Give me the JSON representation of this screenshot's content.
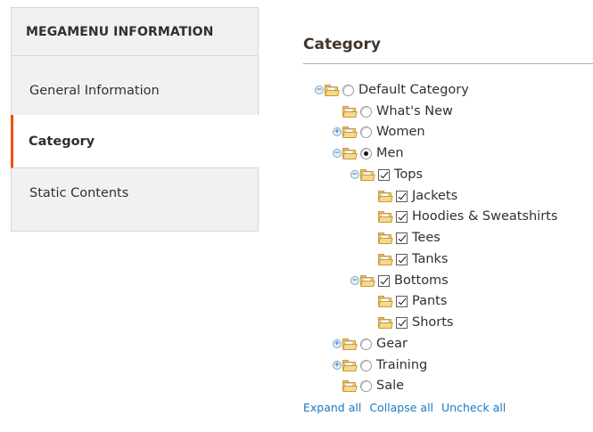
{
  "sidebar": {
    "title": "MEGAMENU INFORMATION",
    "tabs": [
      {
        "label": "General Information"
      },
      {
        "label": "Category"
      },
      {
        "label": "Static Contents"
      }
    ],
    "active_tab": "Category",
    "accent_color": "#eb5202"
  },
  "main": {
    "title": "Category",
    "tree": [
      {
        "label": "Default Category",
        "toggle": "minus",
        "control": "radio",
        "checked": false
      },
      {
        "label": "What's New",
        "toggle": "none",
        "control": "radio",
        "checked": false
      },
      {
        "label": "Women",
        "toggle": "plus",
        "control": "radio",
        "checked": false
      },
      {
        "label": "Men",
        "toggle": "minus",
        "control": "radio",
        "checked": true
      },
      {
        "label": "Tops",
        "toggle": "minus",
        "control": "checkbox",
        "checked": true
      },
      {
        "label": "Jackets",
        "toggle": "none",
        "control": "checkbox",
        "checked": true
      },
      {
        "label": "Hoodies & Sweatshirts",
        "toggle": "none",
        "control": "checkbox",
        "checked": true
      },
      {
        "label": "Tees",
        "toggle": "none",
        "control": "checkbox",
        "checked": true
      },
      {
        "label": "Tanks",
        "toggle": "none",
        "control": "checkbox",
        "checked": true
      },
      {
        "label": "Bottoms",
        "toggle": "minus",
        "control": "checkbox",
        "checked": true
      },
      {
        "label": "Pants",
        "toggle": "none",
        "control": "checkbox",
        "checked": true
      },
      {
        "label": "Shorts",
        "toggle": "none",
        "control": "checkbox",
        "checked": true
      },
      {
        "label": "Gear",
        "toggle": "plus",
        "control": "radio",
        "checked": false
      },
      {
        "label": "Training",
        "toggle": "plus",
        "control": "radio",
        "checked": false
      },
      {
        "label": "Sale",
        "toggle": "none",
        "control": "radio",
        "checked": false
      }
    ],
    "actions": {
      "expand_all": "Expand all",
      "collapse_all": "Collapse all",
      "uncheck_all": "Uncheck all"
    },
    "link_color": "#1979c3"
  }
}
